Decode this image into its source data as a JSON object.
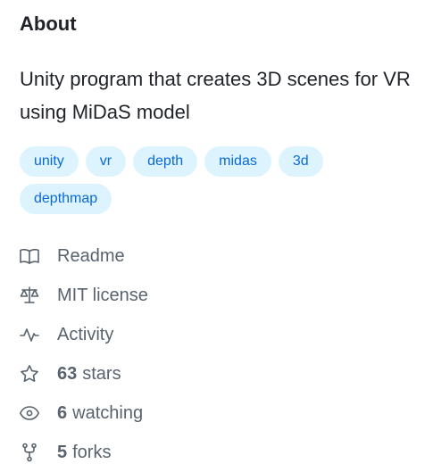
{
  "about": {
    "title": "About",
    "description": "Unity program that creates 3D scenes for VR using MiDaS model",
    "topics": [
      "unity",
      "vr",
      "depth",
      "midas",
      "3d",
      "depthmap"
    ]
  },
  "meta": {
    "readme": {
      "icon": "book-icon",
      "label": "Readme"
    },
    "license": {
      "icon": "law-icon",
      "label": "MIT license"
    },
    "activity": {
      "icon": "pulse-icon",
      "label": "Activity"
    },
    "stars": {
      "icon": "star-icon",
      "count": "63",
      "label": "stars"
    },
    "watching": {
      "icon": "eye-icon",
      "count": "6",
      "label": "watching"
    },
    "forks": {
      "icon": "repo-forked-icon",
      "count": "5",
      "label": "forks"
    }
  },
  "colors": {
    "topic_bg": "#ddf4ff",
    "topic_fg": "#0969da",
    "muted": "#59636e",
    "text": "#1f2328"
  }
}
